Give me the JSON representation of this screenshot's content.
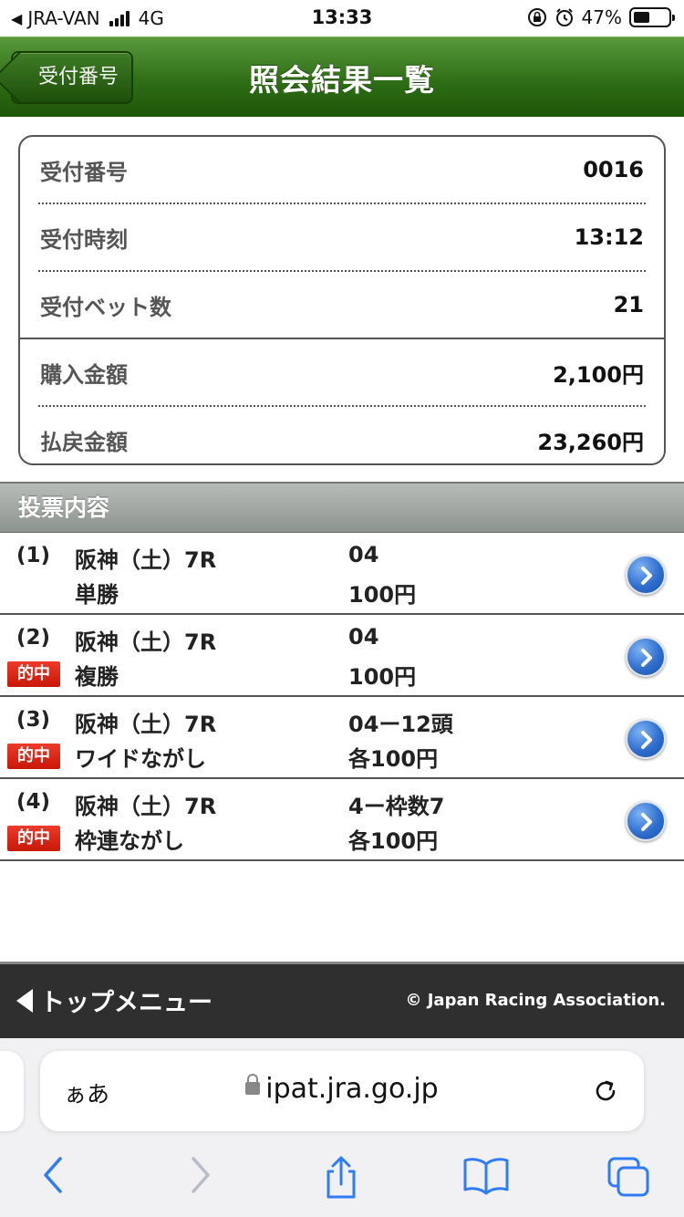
{
  "status_bar": {
    "carrier": "JRA-VAN",
    "network": "4G",
    "time": "13:33",
    "battery": "47%"
  },
  "header": {
    "back_label": "受付番号",
    "title": "照会結果一覧"
  },
  "summary": [
    {
      "label": "受付番号",
      "value": "0016"
    },
    {
      "label": "受付時刻",
      "value": "13:12"
    },
    {
      "label": "受付ベット数",
      "value": "21"
    },
    {
      "label": "購入金額",
      "value": "2,100円"
    },
    {
      "label": "払戻金額",
      "value": "23,260円"
    }
  ],
  "section_title": "投票内容",
  "bets": [
    {
      "num": "(1)",
      "hit": "",
      "race": "阪神（土）7R",
      "type": "単勝",
      "selection": "04",
      "amount": "100円"
    },
    {
      "num": "(2)",
      "hit": "的中",
      "race": "阪神（土）7R",
      "type": "複勝",
      "selection": "04",
      "amount": "100円"
    },
    {
      "num": "(3)",
      "hit": "的中",
      "race": "阪神（土）7R",
      "type": "ワイドながし",
      "selection": "04ー12頭",
      "amount": "各100円"
    },
    {
      "num": "(4)",
      "hit": "的中",
      "race": "阪神（土）7R",
      "type": "枠連ながし",
      "selection": "4ー枠数7",
      "amount": "各100円"
    }
  ],
  "footer": {
    "top_menu": "トップメニュー",
    "copyright": "© Japan Racing Association."
  },
  "browser": {
    "text_size": "ぁあ",
    "url": "ipat.jra.go.jp"
  },
  "colors": {
    "header_green": "#2f6e16",
    "hit_red": "#d82010",
    "arrow_blue": "#2f6fd0",
    "footer_dark": "#2f2f2f"
  },
  "icons": [
    "back-arrow-icon",
    "signal-icon",
    "orientation-lock-icon",
    "alarm-icon",
    "battery-icon",
    "chevron-right-circle-icon",
    "lock-icon",
    "reload-icon",
    "back-icon",
    "forward-icon",
    "share-icon",
    "bookmarks-icon",
    "tabs-icon"
  ]
}
